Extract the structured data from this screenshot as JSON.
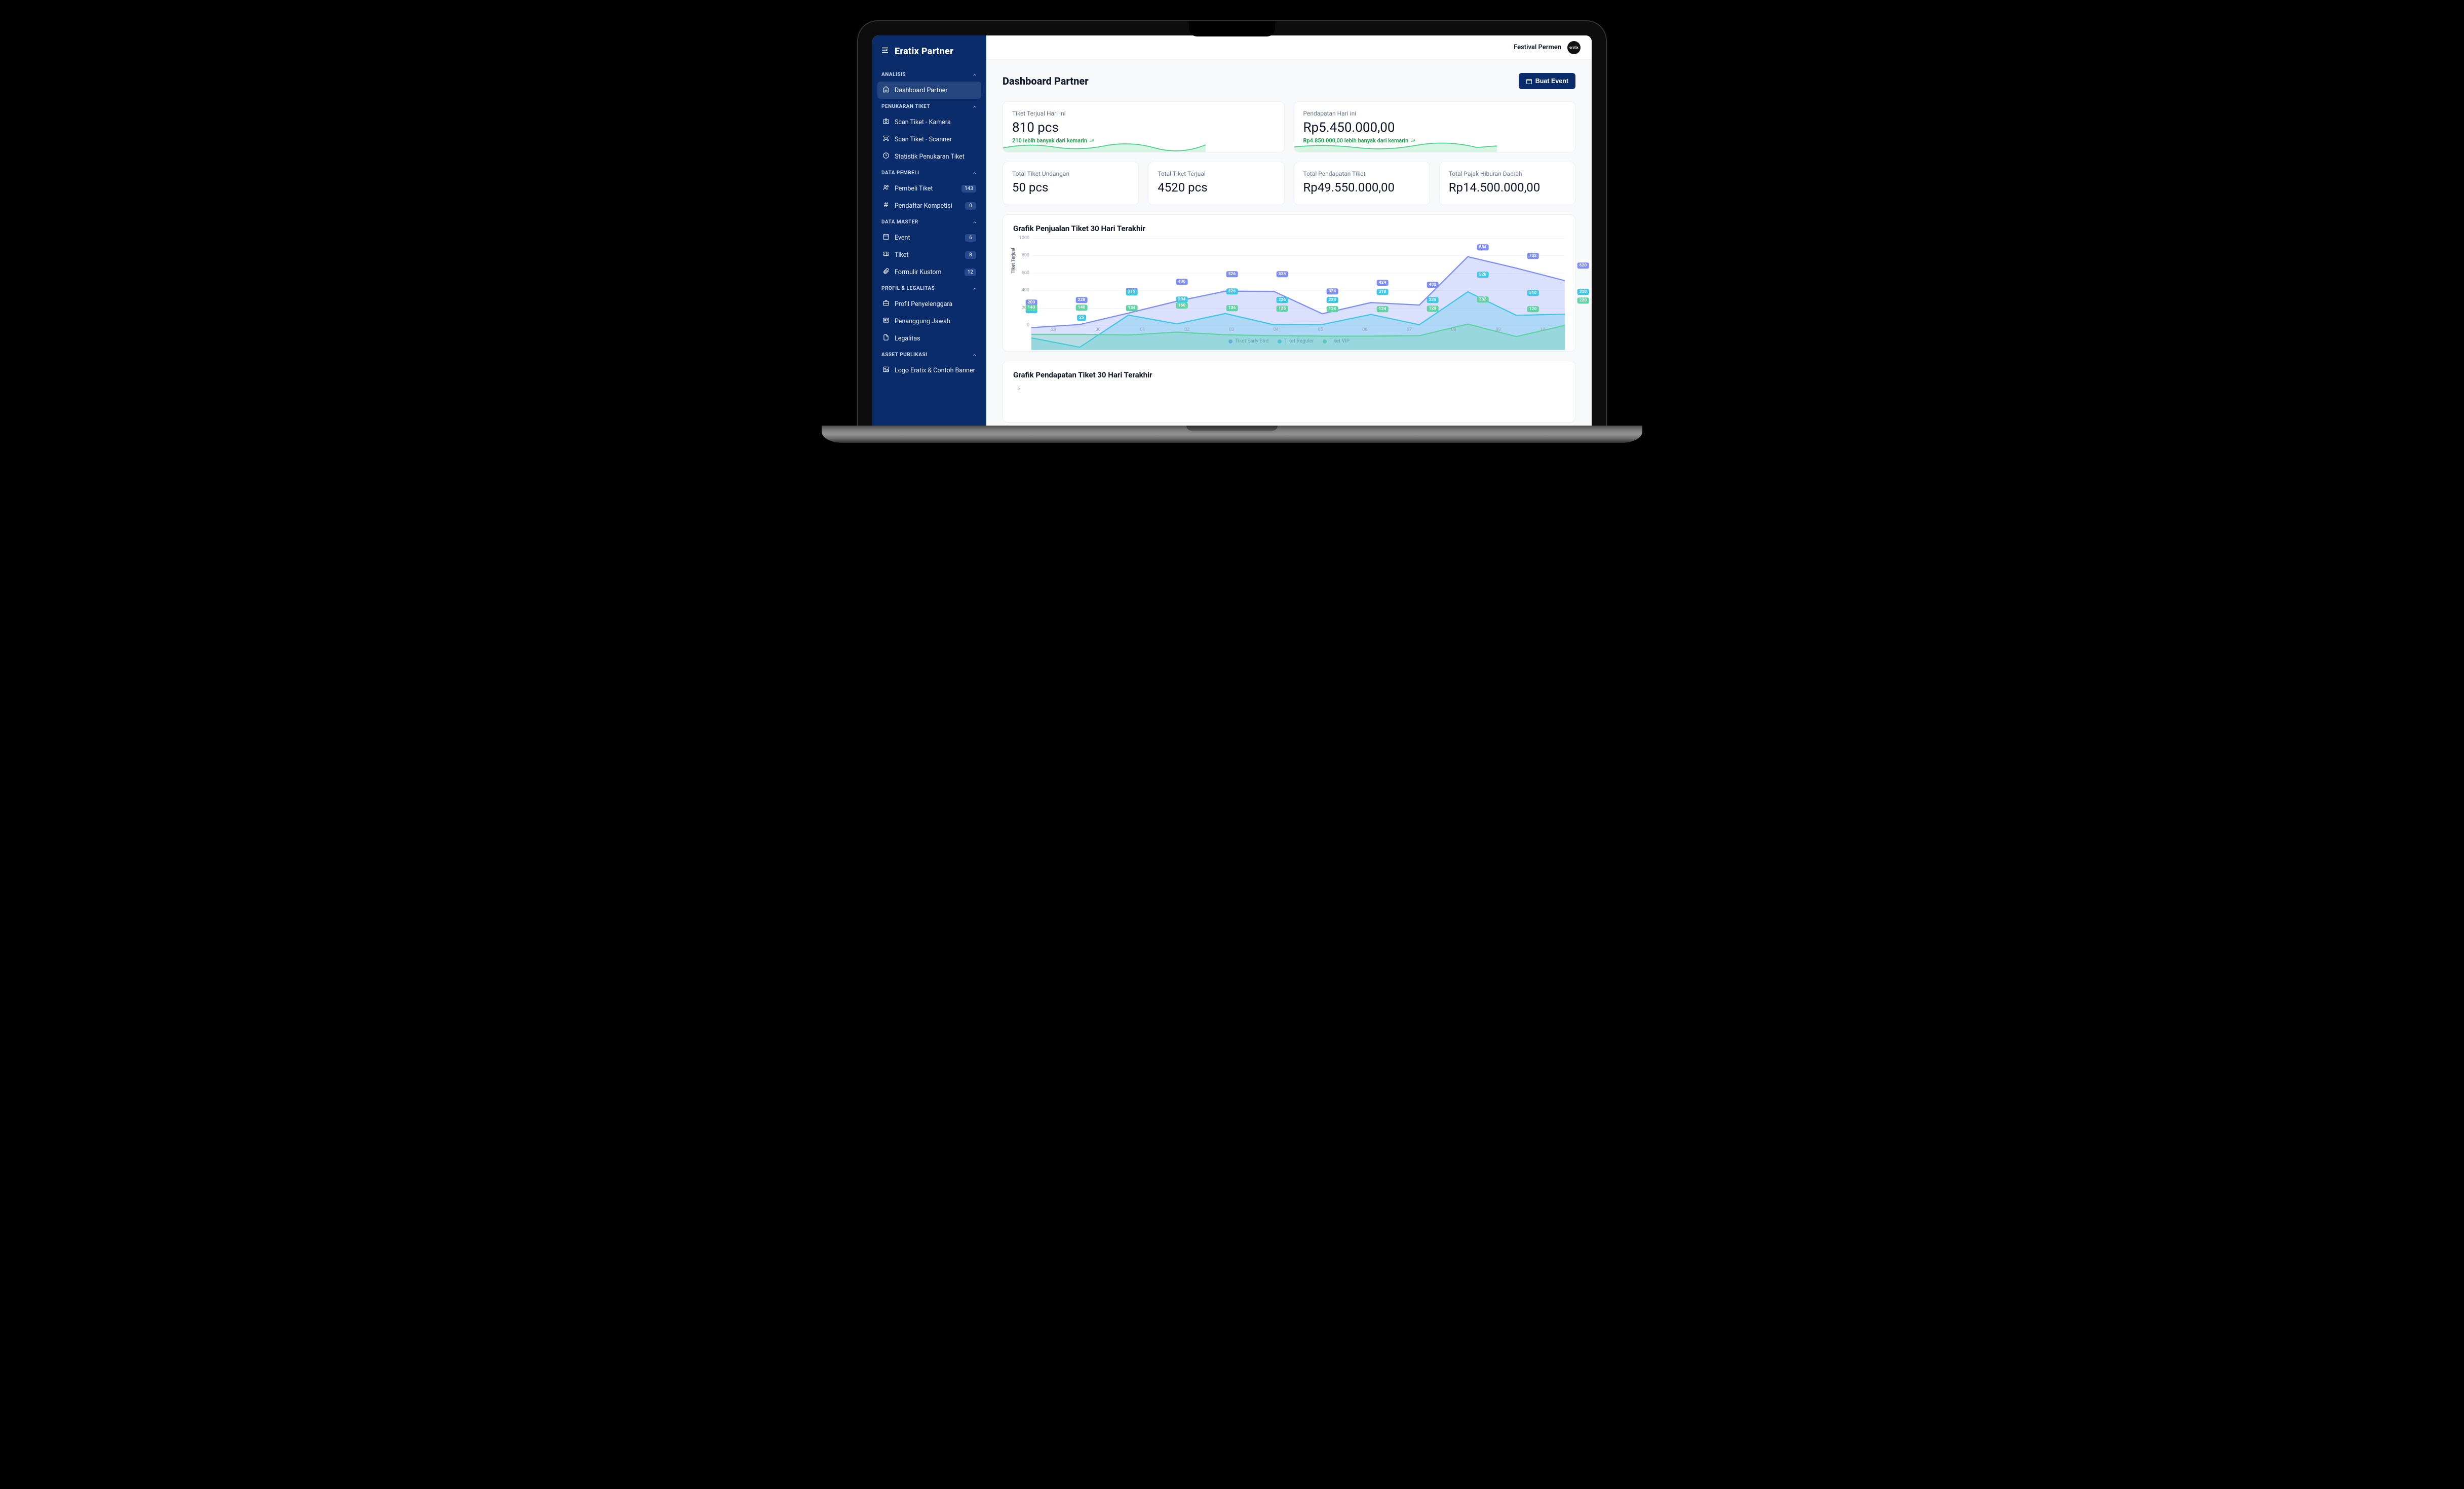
{
  "brand": "Eratix Partner",
  "topbar": {
    "org": "Festival Permen",
    "avatar_text": "eratix"
  },
  "page": {
    "title": "Dashboard Partner",
    "create_button": "Buat Event"
  },
  "sidebar": {
    "groups": [
      {
        "title": "ANALISIS",
        "items": [
          {
            "label": "Dashboard Partner",
            "icon": "home",
            "active": true
          }
        ]
      },
      {
        "title": "PENUKARAN TIKET",
        "items": [
          {
            "label": "Scan Tiket - Kamera",
            "icon": "camera"
          },
          {
            "label": "Scan Tiket - Scanner",
            "icon": "scan"
          },
          {
            "label": "Statistik Penukaran Tiket",
            "icon": "clock"
          }
        ]
      },
      {
        "title": "DATA PEMBELI",
        "items": [
          {
            "label": "Pembeli Tiket",
            "icon": "users",
            "badge": "143"
          },
          {
            "label": "Pendaftar Kompetisi",
            "icon": "hash",
            "badge": "0"
          }
        ]
      },
      {
        "title": "DATA MASTER",
        "items": [
          {
            "label": "Event",
            "icon": "calendar",
            "badge": "6"
          },
          {
            "label": "Tiket",
            "icon": "ticket",
            "badge": "8"
          },
          {
            "label": "Formulir Kustom",
            "icon": "clip",
            "badge": "12"
          }
        ]
      },
      {
        "title": "PROFIL & LEGALITAS",
        "items": [
          {
            "label": "Profil Penyelenggara",
            "icon": "briefcase"
          },
          {
            "label": "Penanggung Jawab",
            "icon": "idcard"
          },
          {
            "label": "Legalitas",
            "icon": "file"
          }
        ]
      },
      {
        "title": "ASSET PUBLIKASI",
        "items": [
          {
            "label": "Logo Eratix & Contoh Banner",
            "icon": "image"
          }
        ]
      }
    ]
  },
  "kpi_today": [
    {
      "label": "Tiket Terjual Hari ini",
      "value": "810 pcs",
      "delta": "210 lebih banyak dari kemarin"
    },
    {
      "label": "Pendapatan Hari ini",
      "value": "Rp5.450.000,00",
      "delta": "Rp4.850.000,00 lebih banyak dari kemarin"
    }
  ],
  "stats": [
    {
      "label": "Total Tiket Undangan",
      "value": "50 pcs"
    },
    {
      "label": "Total Tiket Terjual",
      "value": "4520 pcs"
    },
    {
      "label": "Total Pendapatan Tiket",
      "value": "Rp49.550.000,00"
    },
    {
      "label": "Total Pajak Hiburan Daerah",
      "value": "Rp14.500.000,00"
    }
  ],
  "chart_sales": {
    "title": "Grafik Penjualan Tiket 30 Hari Terakhir",
    "ylabel": "Tiket Terjual"
  },
  "chart_revenue": {
    "title": "Grafik Pendapatan Tiket 30 Hari Terakhir",
    "ytick": "5"
  },
  "chart_data": {
    "type": "area",
    "title": "Grafik Penjualan Tiket 30 Hari Terakhir",
    "xlabel": "",
    "ylabel": "Tiket Terjual",
    "ylim": [
      0,
      1000
    ],
    "yticks": [
      0,
      200,
      400,
      600,
      800,
      1000
    ],
    "categories": [
      "29",
      "30",
      "01",
      "02",
      "03",
      "04",
      "05",
      "06",
      "07",
      "08",
      "09",
      "10"
    ],
    "series": [
      {
        "name": "Tiket Early Bird",
        "color": "#7e8ef6",
        "values": [
          200,
          228,
          330,
          436,
          526,
          524,
          324,
          424,
          402,
          834,
          732,
          620
        ]
      },
      {
        "name": "Tiket Reguler",
        "color": "#3ec7e6",
        "values": [
          108,
          25,
          312,
          234,
          326,
          226,
          228,
          318,
          226,
          520,
          310,
          320
        ]
      },
      {
        "name": "Tiket VIP",
        "color": "#5fd3a2",
        "values": [
          140,
          140,
          134,
          160,
          136,
          128,
          124,
          124,
          128,
          232,
          120,
          220
        ]
      }
    ],
    "legend_position": "bottom"
  }
}
